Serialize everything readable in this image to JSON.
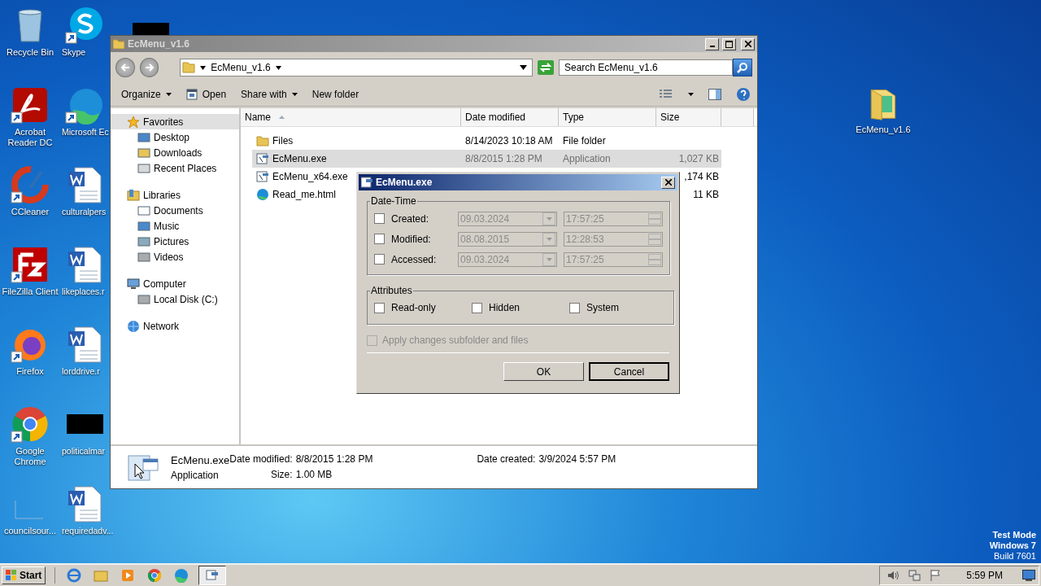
{
  "desktop_icons": [
    {
      "label": "Recycle Bin",
      "kind": "file"
    },
    {
      "label": "Acrobat Reader DC",
      "kind": "shortcut"
    },
    {
      "label": "CCleaner",
      "kind": "shortcut"
    },
    {
      "label": "FileZilla Client",
      "kind": "shortcut"
    },
    {
      "label": "Firefox",
      "kind": "shortcut"
    },
    {
      "label": "Google Chrome",
      "kind": "shortcut"
    },
    {
      "label": "councilsour...",
      "kind": "file"
    },
    {
      "label": "Skype",
      "kind": "shortcut"
    },
    {
      "label": "Microsoft Ec",
      "kind": "shortcut"
    },
    {
      "label": "culturalpers",
      "kind": "file"
    },
    {
      "label": "likeplaces.r",
      "kind": "file"
    },
    {
      "label": "lorddrive.r",
      "kind": "file"
    },
    {
      "label": "politicalmar",
      "kind": "redacted"
    },
    {
      "label": "requiredadv...",
      "kind": "file"
    }
  ],
  "desktop_folder": {
    "label": "EcMenu_v1.6"
  },
  "os_notice": [
    "Test Mode",
    "Windows 7",
    "Build 7601"
  ],
  "explorer": {
    "title": "EcMenu_v1.6",
    "breadcrumb": "EcMenu_v1.6",
    "search": {
      "placeholder": "Search EcMenu_v1.6"
    },
    "toolbar": [
      "Organize",
      "Open",
      "Share with",
      "New folder"
    ],
    "nav": [
      {
        "label": "Favorites",
        "selected": true,
        "children": [
          {
            "label": "Desktop",
            "selected": false
          },
          {
            "label": "Downloads",
            "selected": false
          },
          {
            "label": "Recent Places",
            "selected": false
          }
        ]
      },
      {
        "label": "Libraries",
        "selected": false,
        "children": [
          {
            "label": "Documents",
            "selected": false
          },
          {
            "label": "Music",
            "selected": false
          },
          {
            "label": "Pictures",
            "selected": false
          },
          {
            "label": "Videos",
            "selected": false
          }
        ]
      },
      {
        "label": "Computer",
        "selected": false,
        "children": [
          {
            "label": "Local Disk (C:)",
            "selected": false
          }
        ]
      },
      {
        "label": "Network",
        "selected": false
      }
    ],
    "columns": [
      "Name",
      "Date modified",
      "Type",
      "Size"
    ],
    "rows": [
      {
        "name": "Files",
        "date": "8/14/2023 10:18 AM",
        "type": "File folder",
        "size": "",
        "selected": false
      },
      {
        "name": "EcMenu.exe",
        "date": "8/8/2015 1:28 PM",
        "type": "Application",
        "size": "1,027 KB",
        "selected": true
      },
      {
        "name": "EcMenu_x64.exe",
        "date": "",
        "type": "",
        "size": ",174 KB",
        "selected": false
      },
      {
        "name": "Read_me.html",
        "date": "",
        "type": "",
        "size": "11 KB",
        "selected": false
      }
    ],
    "details": {
      "name": "EcMenu.exe",
      "type": "Application",
      "fields": [
        {
          "label": "Date modified:",
          "value": "8/8/2015 1:28 PM"
        },
        {
          "label": "Size:",
          "value": "1.00 MB"
        },
        {
          "label": "Date created:",
          "value": "3/9/2024 5:57 PM"
        }
      ]
    }
  },
  "dialog": {
    "title": "EcMenu.exe",
    "datetime_group": "Date-Time",
    "dates": [
      {
        "label": "Created:",
        "checked": false,
        "date": "09.03.2024",
        "time": "17:57:25"
      },
      {
        "label": "Modified:",
        "checked": false,
        "date": "08.08.2015",
        "time": "12:28:53"
      },
      {
        "label": "Accessed:",
        "checked": false,
        "date": "09.03.2024",
        "time": "17:57:25"
      }
    ],
    "attributes_group": "Attributes",
    "attributes": [
      {
        "label": "Read-only",
        "checked": false
      },
      {
        "label": "Hidden",
        "checked": false
      },
      {
        "label": "System",
        "checked": false
      }
    ],
    "apply": {
      "label": "Apply changes subfolder and files",
      "checked": false,
      "disabled": true
    },
    "buttons": [
      {
        "label": "OK",
        "default": false
      },
      {
        "label": "Cancel",
        "default": true
      }
    ]
  },
  "taskbar": {
    "start": "Start",
    "apps": [
      {
        "selected": false
      },
      {
        "selected": false
      },
      {
        "selected": false
      },
      {
        "selected": false
      },
      {
        "selected": false
      },
      {
        "selected": true
      }
    ],
    "clock": "5:59 PM"
  }
}
